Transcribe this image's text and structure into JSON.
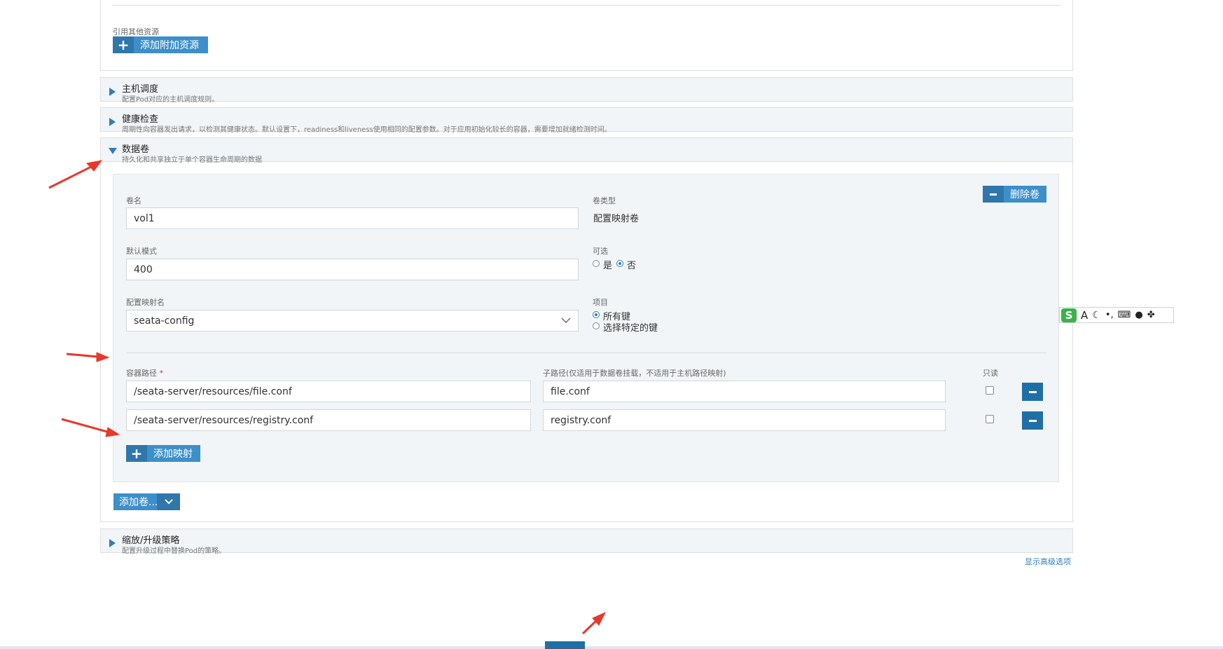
{
  "top": {
    "ref_label": "引用其他资源",
    "add_resource_button": "添加附加资源"
  },
  "sections": {
    "host_scheduling": {
      "title": "主机调度",
      "desc": "配置Pod对应的主机调度规则。"
    },
    "health_check": {
      "title": "健康检查",
      "desc": "周期性向容器发出请求，以检测其健康状态。默认设置下，readiness和liveness使用相同的配置参数。对于应用初始化较长的容器，需要增加就绪检测时间。"
    },
    "volumes": {
      "title": "数据卷",
      "desc": "持久化和共享独立于单个容器生命周期的数据"
    },
    "scaling": {
      "title": "缩放/升级策略",
      "desc": "配置升级过程中替换Pod的策略。"
    }
  },
  "volume": {
    "delete_button": "删除卷",
    "name_label": "卷名",
    "name_value": "vol1",
    "type_label": "卷类型",
    "type_value": "配置映射卷",
    "mode_label": "默认模式",
    "mode_value": "400",
    "optional_label": "可选",
    "optional_yes": "是",
    "optional_no": "否",
    "optional_selected": "否",
    "configmap_label": "配置映射名",
    "configmap_value": "seata-config",
    "items_label": "项目",
    "items_all": "所有键",
    "items_specific": "选择特定的键",
    "items_selected": "所有键",
    "mount_path_label": "容器路径",
    "required_mark": "*",
    "sub_path_label": "子路径(仅适用于数据卷挂载，不适用于主机路径映射)",
    "readonly_label": "只读",
    "mounts": [
      {
        "path": "/seata-server/resources/file.conf",
        "sub_path": "file.conf",
        "readonly": false
      },
      {
        "path": "/seata-server/resources/registry.conf",
        "sub_path": "registry.conf",
        "readonly": false
      }
    ],
    "add_mount_button": "添加映射"
  },
  "add_volume_button": "添加卷...",
  "show_advanced_link": "显示高级选项",
  "ime_toolbar": {
    "logo": "S",
    "font": "A"
  },
  "colors": {
    "accent": "#3d8fc9",
    "accent_dark": "#1f6fa6",
    "annotation": "#e8382a"
  }
}
